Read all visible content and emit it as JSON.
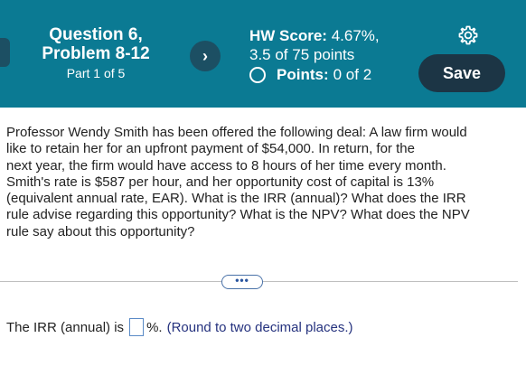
{
  "header": {
    "question_line1": "Question 6,",
    "question_line2": "Problem 8-12",
    "part": "Part 1 of 5",
    "hw_score_label": "HW Score:",
    "hw_score_value": "4.67%,",
    "hw_points": "3.5 of 75 points",
    "points_label": "Points:",
    "points_value": "0 of 2",
    "next_icon": "chevron-right-icon",
    "settings_icon": "gear-icon",
    "save_label": "Save"
  },
  "question": {
    "lines": [
      "Professor Wendy Smith has been offered the following deal: A law firm would",
      "like to retain her for an upfront payment of $54,000. In return, for the",
      "next year, the firm would have access to 8 hours of her time every month.",
      "Smith's rate is $587 per hour, and her opportunity cost of capital is 13%",
      "(equivalent annual rate, EAR). What is the IRR (annual)? What does the IRR",
      "rule advise regarding this opportunity? What is the NPV? What does the NPV",
      "rule say about this opportunity?"
    ]
  },
  "more_label": "•••",
  "answer": {
    "prefix": "The IRR (annual) is",
    "value": "",
    "suffix": "%.",
    "hint": "(Round to two decimal places.)"
  },
  "colors": {
    "header_bg": "#0b7a93",
    "button_dark": "#1c3545",
    "hint_text": "#25327e"
  }
}
